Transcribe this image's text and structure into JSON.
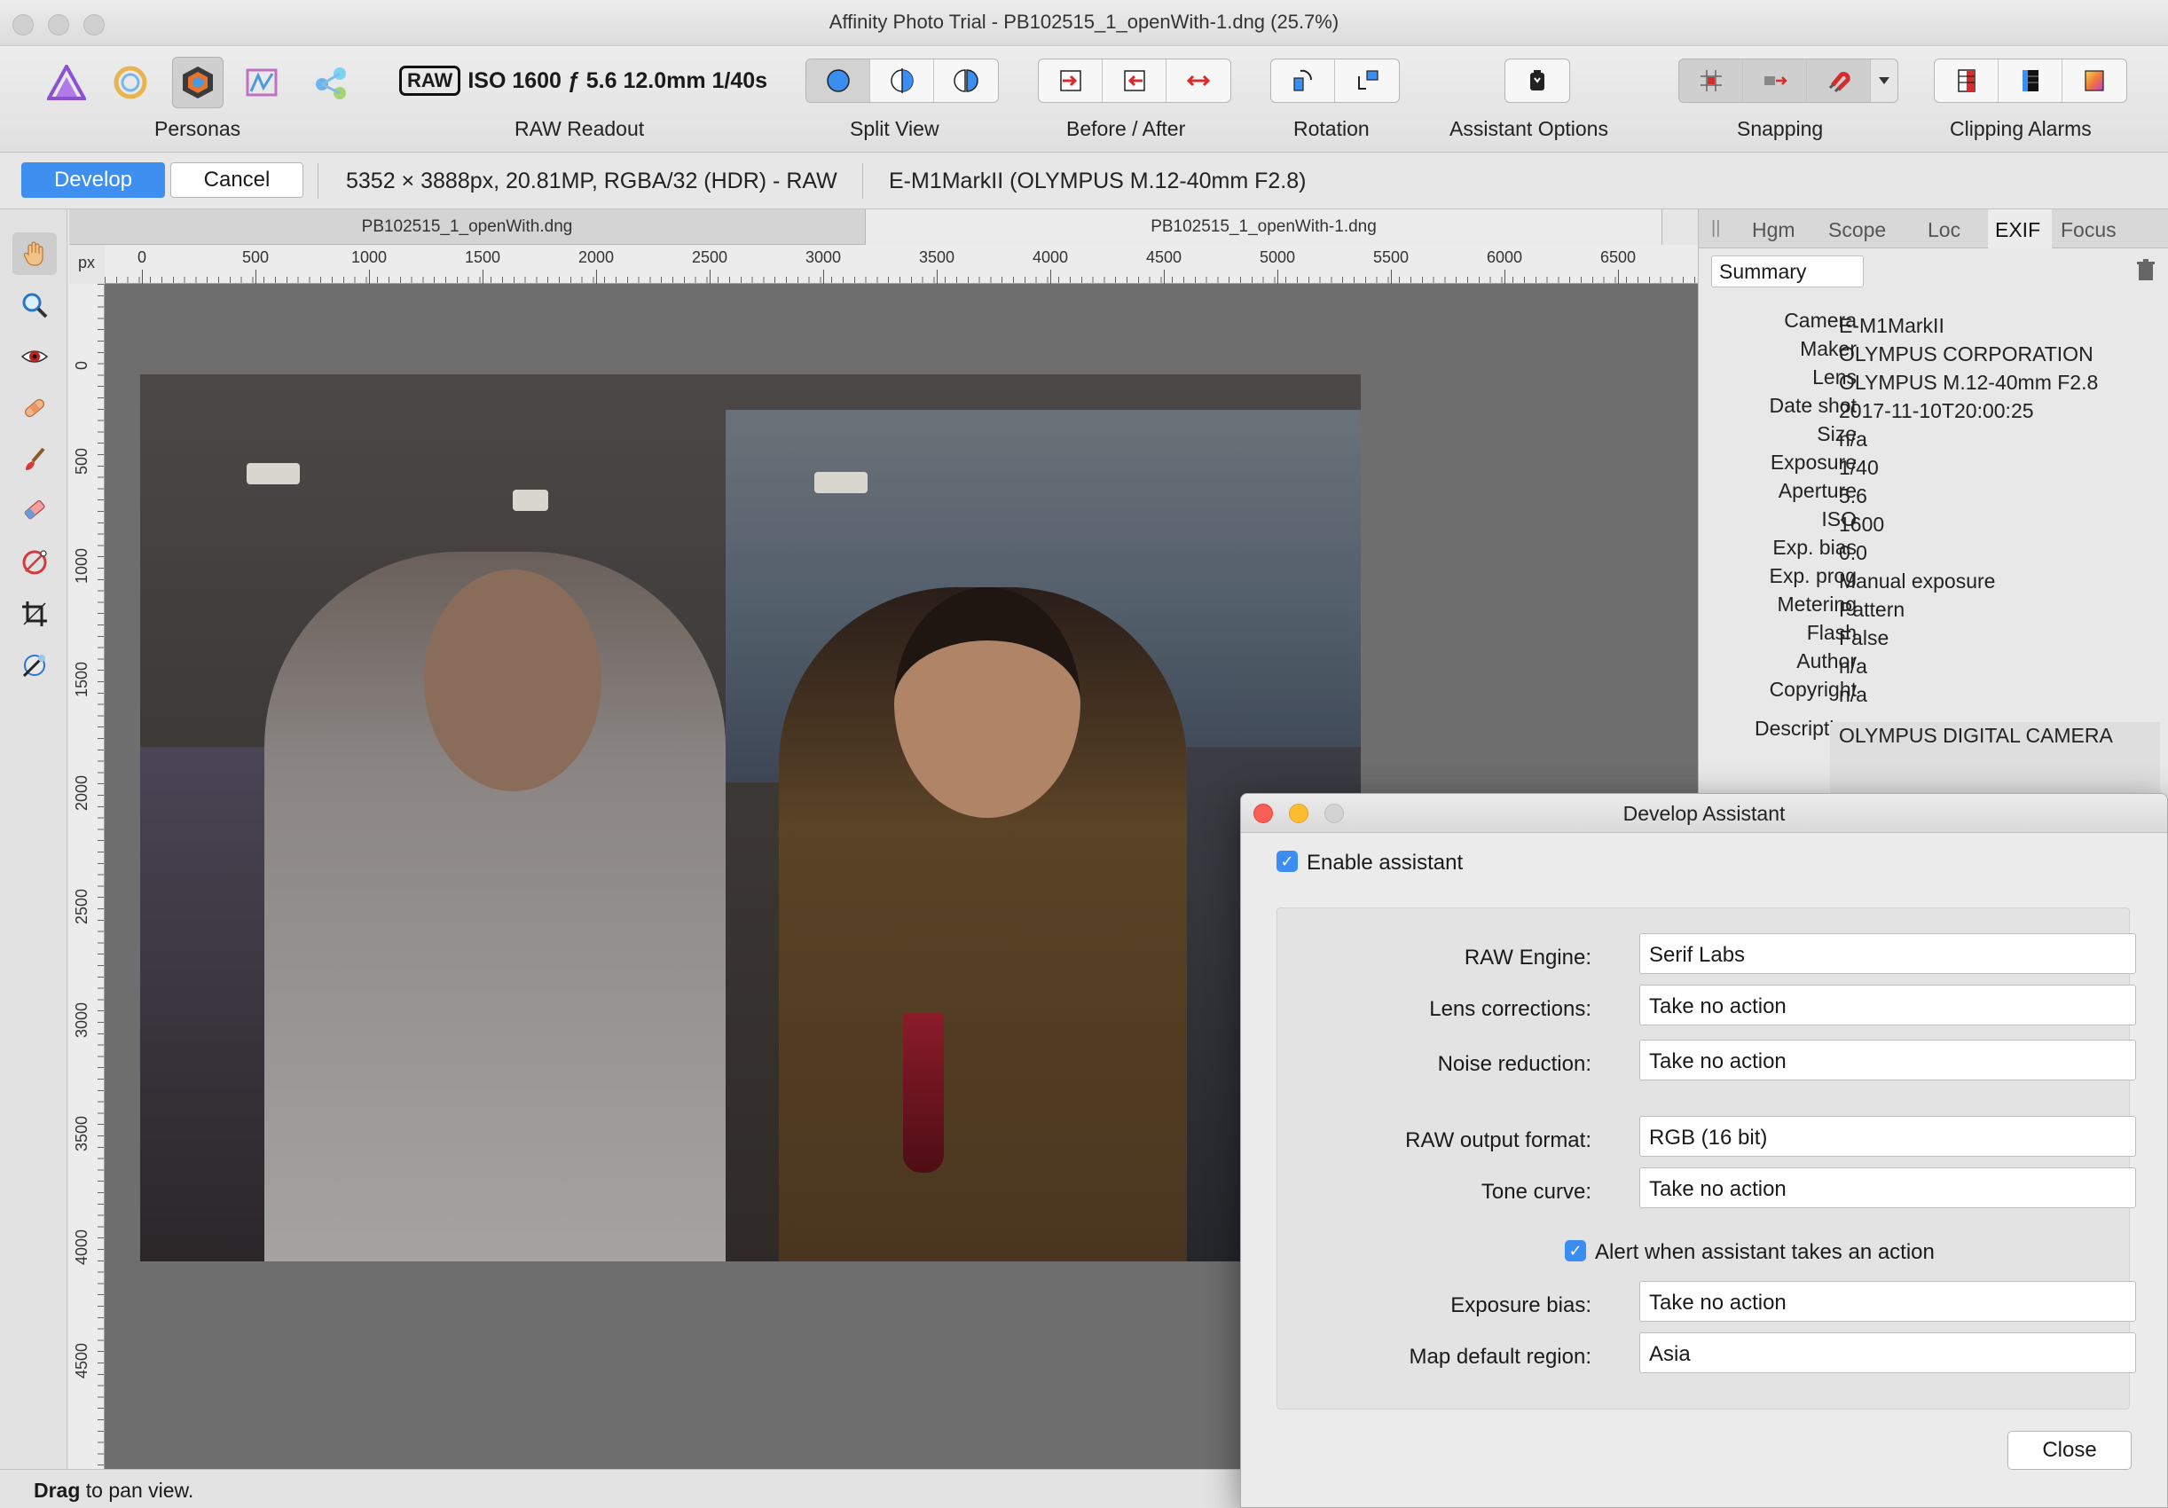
{
  "window": {
    "title": "Affinity Photo Trial - PB102515_1_openWith-1.dng (25.7%)"
  },
  "toolbar": {
    "personas_label": "Personas",
    "raw_badge": "RAW",
    "raw_readout_values": "ISO 1600 ƒ 5.6 12.0mm 1/40s",
    "raw_readout_label": "RAW Readout",
    "split_view_label": "Split View",
    "before_after_label": "Before / After",
    "rotation_label": "Rotation",
    "assistant_options_label": "Assistant Options",
    "snapping_label": "Snapping",
    "clipping_alarms_label": "Clipping Alarms"
  },
  "context": {
    "develop_label": "Develop",
    "cancel_label": "Cancel",
    "image_info": "5352 × 3888px, 20.81MP, RGBA/32 (HDR) - RAW",
    "camera_info": "E-M1MarkII (OLYMPUS M.12-40mm F2.8)"
  },
  "doc_tabs": [
    "PB102515_1_openWith.dng",
    "PB102515_1_openWith-1.dng"
  ],
  "ruler": {
    "unit": "px",
    "h_ticks": [
      "0",
      "500",
      "1000",
      "1500",
      "2000",
      "2500",
      "3000",
      "3500",
      "4000",
      "4500",
      "5000",
      "5500",
      "6000",
      "6500"
    ],
    "v_ticks": [
      "0",
      "500",
      "1000",
      "1500",
      "2000",
      "2500",
      "3000",
      "3500",
      "4000",
      "4500"
    ]
  },
  "right_panel": {
    "tabs": [
      "Hgm",
      "Scope",
      "Loc",
      "EXIF",
      "Focus"
    ],
    "active_tab": "EXIF",
    "summary_select": "Summary",
    "exif": [
      {
        "label": "Camera",
        "value": "E-M1MarkII"
      },
      {
        "label": "Maker",
        "value": "OLYMPUS CORPORATION"
      },
      {
        "label": "Lens",
        "value": "OLYMPUS M.12-40mm F2.8"
      },
      {
        "label": "Date shot",
        "value": "2017-11-10T20:00:25"
      },
      {
        "label": "Size",
        "value": "n/a"
      },
      {
        "label": "Exposure",
        "value": "1/40"
      },
      {
        "label": "Aperture",
        "value": "5.6"
      },
      {
        "label": "ISO",
        "value": "1600"
      },
      {
        "label": "Exp. bias",
        "value": "0.0"
      },
      {
        "label": "Exp. prog",
        "value": "Manual exposure"
      },
      {
        "label": "Metering",
        "value": "Pattern"
      },
      {
        "label": "Flash",
        "value": "False"
      },
      {
        "label": "Author",
        "value": "n/a"
      },
      {
        "label": "Copyright",
        "value": "n/a"
      },
      {
        "label": "Description",
        "value": "OLYMPUS DIGITAL CAMERA"
      }
    ]
  },
  "dialog": {
    "title": "Develop Assistant",
    "enable_assistant_label": "Enable assistant",
    "enable_assistant_checked": true,
    "raw_engine_label": "RAW Engine:",
    "raw_engine_value": "Serif Labs",
    "lens_corrections_label": "Lens corrections:",
    "lens_corrections_value": "Take no action",
    "noise_reduction_label": "Noise reduction:",
    "noise_reduction_value": "Take no action",
    "raw_output_label": "RAW output format:",
    "raw_output_value": "RGB (16 bit)",
    "tone_curve_label": "Tone curve:",
    "tone_curve_value": "Take no action",
    "alert_label": "Alert when assistant takes an action",
    "alert_checked": true,
    "exposure_bias_label": "Exposure bias:",
    "exposure_bias_value": "Take no action",
    "map_region_label": "Map default region:",
    "map_region_value": "Asia",
    "close_label": "Close"
  },
  "status": {
    "bold": "Drag",
    "text": " to pan view."
  },
  "colors": {
    "accent": "#3f8ff1",
    "canvas_bg": "#6e6e6e",
    "close_red": "#fc5f57",
    "minimize_yellow": "#fdbc2e"
  }
}
